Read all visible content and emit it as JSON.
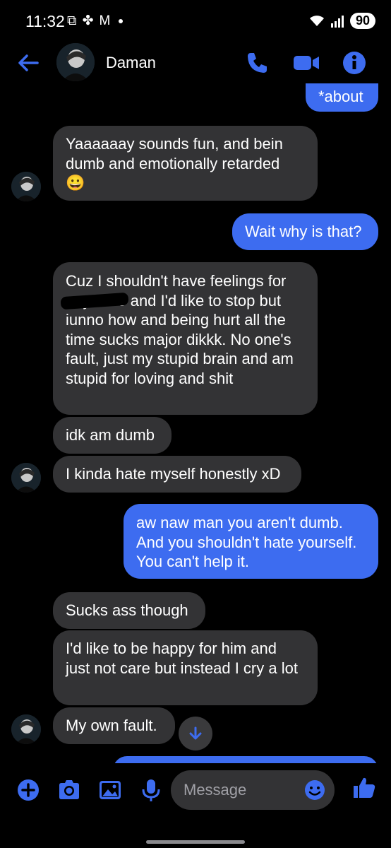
{
  "status_bar": {
    "time": "11:32",
    "battery": "90"
  },
  "header": {
    "contact_name": "Daman",
    "accent_color": "#3d6cf0"
  },
  "messages": [
    {
      "from": "me",
      "text": "*about"
    },
    {
      "from": "them",
      "text": "Yaaaaaay sounds fun, and bein dumb and emotionally retarded\n😀"
    },
    {
      "from": "me",
      "text": "Wait why is that?"
    },
    {
      "from": "them",
      "text": "Cuz I shouldn't have feelings for\n          anymore and I'd like to stop but iunno how and being hurt all the time sucks major dikkk. No one's fault, just my stupid brain and am stupid for loving and shit"
    },
    {
      "from": "them",
      "text": "idk am dumb"
    },
    {
      "from": "them",
      "text": "I kinda hate myself honestly xD"
    },
    {
      "from": "me",
      "text": "aw naw man you aren't dumb. And you shouldn't hate yourself. You can't help it."
    },
    {
      "from": "them",
      "text": "Sucks ass though"
    },
    {
      "from": "them",
      "text": "I'd like to be happy for him and just not care but instead I cry a lot"
    },
    {
      "from": "them",
      "text": "My own fault."
    }
  ],
  "composer": {
    "placeholder": "Message"
  }
}
